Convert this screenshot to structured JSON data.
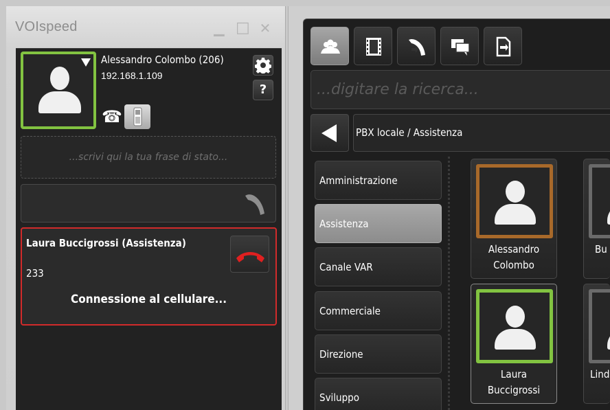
{
  "left_window": {
    "title": "VOIspeed",
    "controls": {
      "minimize": "▁",
      "maximize": "□",
      "close": "✕"
    },
    "user": {
      "name": "Alessandro Colombo (206)",
      "ip": "192.168.1.109",
      "presence_color": "#82c341"
    },
    "help_label": "?",
    "status_placeholder": "...scrivi qui la tua frase di stato...",
    "call": {
      "caller_name": "Laura Buccigrossi (Assistenza)",
      "caller_ext": "233",
      "status": "Connessione al cellulare...",
      "border_color": "#d22b2b"
    }
  },
  "right_window": {
    "toolbar": [
      {
        "icon": "contacts-icon",
        "active": true
      },
      {
        "icon": "film-icon",
        "active": false
      },
      {
        "icon": "call-transfer-icon",
        "active": false
      },
      {
        "icon": "chat-icon",
        "active": false
      },
      {
        "icon": "phone-forward-icon",
        "active": false
      }
    ],
    "search_placeholder": "...digitare la ricerca...",
    "breadcrumb": "PBX locale / Assistenza",
    "groups": [
      "Amministrazione",
      "Assistenza",
      "Canale VAR",
      "Commerciale",
      "Direzione",
      "Sviluppo"
    ],
    "active_group": "Assistenza",
    "contacts": [
      {
        "name_line1": "Alessandro",
        "name_line2": "Colombo",
        "status_color": "#a8692a"
      },
      {
        "name_line1": "Bu",
        "name_line2": "",
        "status_color": "#6a6a6a"
      },
      {
        "name_line1": "Laura",
        "name_line2": "Buccigrossi",
        "status_color": "#82c341"
      },
      {
        "name_line1": "Lind",
        "name_line2": "",
        "status_color": "#6a6a6a"
      }
    ]
  }
}
